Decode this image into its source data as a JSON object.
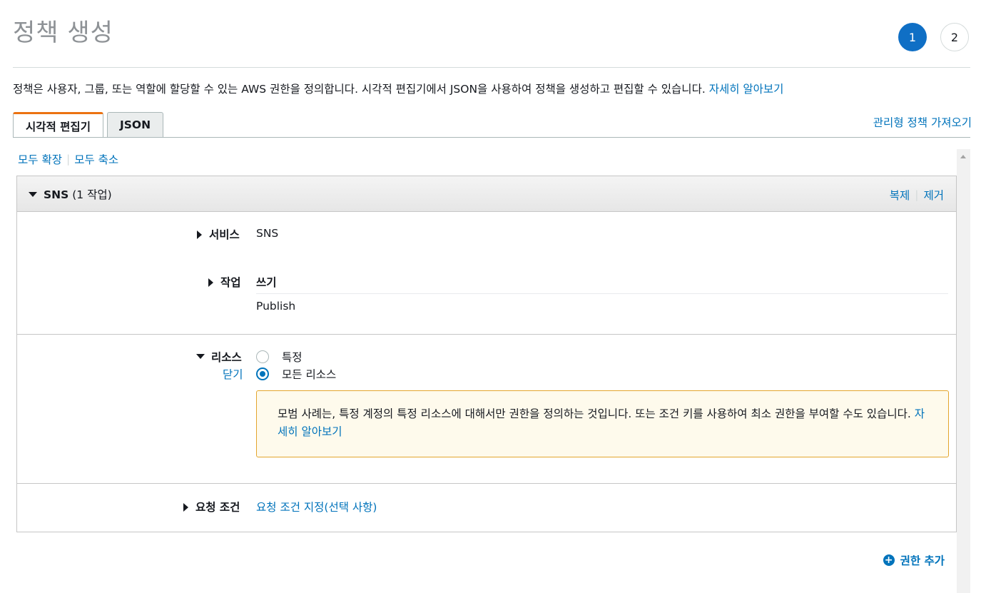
{
  "header": {
    "title": "정책 생성",
    "steps": [
      "1",
      "2"
    ]
  },
  "description": {
    "text": "정책은 사용자, 그룹, 또는 역할에 할당할 수 있는 AWS 권한을 정의합니다. 시각적 편집기에서 JSON을 사용하여 정책을 생성하고 편집할 수 있습니다. ",
    "link": "자세히 알아보기"
  },
  "tabs": [
    {
      "label": "시각적 편집기",
      "active": true
    },
    {
      "label": "JSON",
      "active": false
    }
  ],
  "import_link": "관리형 정책 가져오기",
  "expand_all": "모두 확장",
  "collapse_all": "모두 축소",
  "block": {
    "service_name": "SNS",
    "action_count": "(1 작업)",
    "clone": "복제",
    "remove": "제거",
    "service_label": "서비스",
    "service_value": "SNS",
    "actions_label": "작업",
    "action_category": "쓰기",
    "action_item": "Publish",
    "resources_label": "리소스",
    "close": "닫기",
    "radio_specific": "특정",
    "radio_all": "모든 리소스",
    "notice_text": "모범 사례는, 특정 계정의 특정 리소스에 대해서만 권한을 정의하는 것입니다. 또는 조건 키를 사용하여 최소 권한을 부여할 수도 있습니다. ",
    "notice_link": "자세히 알아보기",
    "conditions_label": "요청 조건",
    "conditions_link": "요청 조건 지정(선택 사항)"
  },
  "add_permission": "권한 추가",
  "colors": {
    "link": "#0073bb",
    "step_active": "#0f6fc5",
    "tab_accent": "#ec7211",
    "notice_border": "#e3a52d",
    "notice_bg": "#fefaec"
  }
}
